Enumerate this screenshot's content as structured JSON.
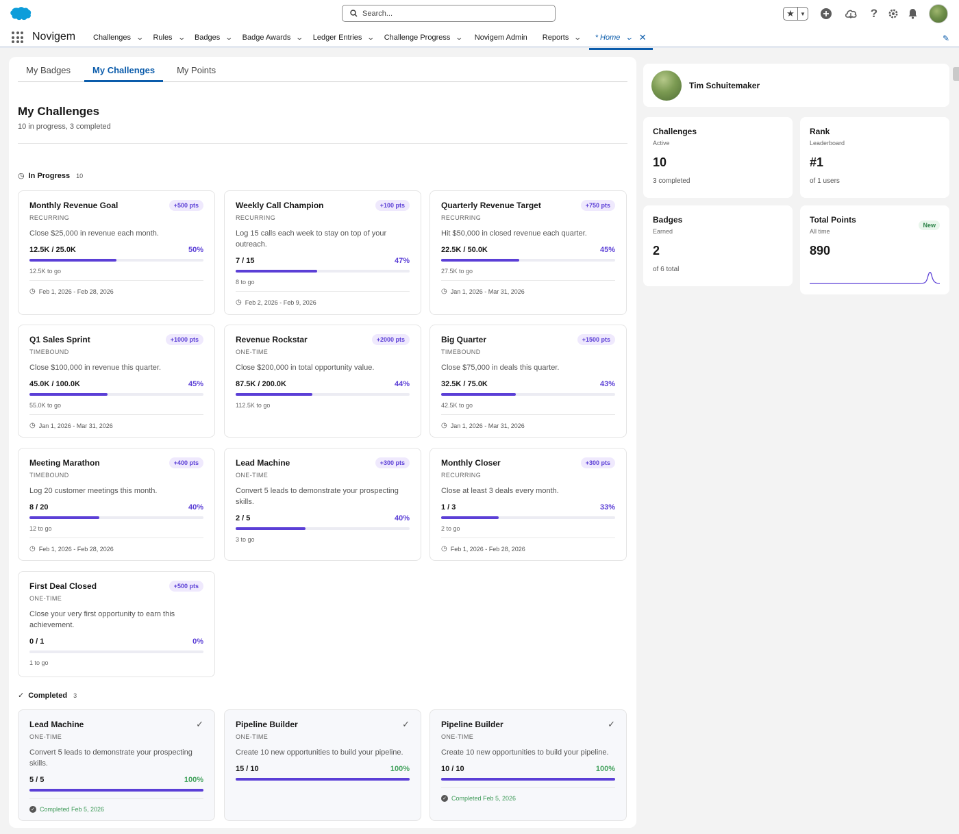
{
  "header": {
    "search_placeholder": "Search...",
    "app_name": "Novigem",
    "nav": [
      {
        "label": "Challenges"
      },
      {
        "label": "Rules"
      },
      {
        "label": "Badges"
      },
      {
        "label": "Badge Awards"
      },
      {
        "label": "Ledger Entries"
      },
      {
        "label": "Challenge Progress"
      },
      {
        "label": "Novigem Admin"
      },
      {
        "label": "Reports"
      },
      {
        "label": "* Home"
      }
    ]
  },
  "tabs": [
    "My Badges",
    "My Challenges",
    "My Points"
  ],
  "page": {
    "title": "My Challenges",
    "subtitle": "10 in progress, 3 completed"
  },
  "sections": {
    "in_progress": {
      "label": "In Progress",
      "count": "10"
    },
    "completed": {
      "label": "Completed",
      "count": "3"
    }
  },
  "in_progress": [
    {
      "name": "Monthly Revenue Goal",
      "points": "+500 pts",
      "type": "RECURRING",
      "desc": "Close $25,000 in revenue each month.",
      "progress": "12.5K / 25.0K",
      "pct": "50%",
      "fraction": 0.5,
      "togo": "12.5K to go",
      "dates": "Feb 1, 2026 - Feb 28, 2026"
    },
    {
      "name": "Weekly Call Champion",
      "points": "+100 pts",
      "type": "RECURRING",
      "desc": "Log 15 calls each week to stay on top of your outreach.",
      "progress": "7 / 15",
      "pct": "47%",
      "fraction": 0.47,
      "togo": "8 to go",
      "dates": "Feb 2, 2026 - Feb 9, 2026"
    },
    {
      "name": "Quarterly Revenue Target",
      "points": "+750 pts",
      "type": "RECURRING",
      "desc": "Hit $50,000 in closed revenue each quarter.",
      "progress": "22.5K / 50.0K",
      "pct": "45%",
      "fraction": 0.45,
      "togo": "27.5K to go",
      "dates": "Jan 1, 2026 - Mar 31, 2026"
    },
    {
      "name": "Q1 Sales Sprint",
      "points": "+1000 pts",
      "type": "TIMEBOUND",
      "desc": "Close $100,000 in revenue this quarter.",
      "progress": "45.0K / 100.0K",
      "pct": "45%",
      "fraction": 0.45,
      "togo": "55.0K to go",
      "dates": "Jan 1, 2026 - Mar 31, 2026"
    },
    {
      "name": "Revenue Rockstar",
      "points": "+2000 pts",
      "type": "ONE-TIME",
      "desc": "Close $200,000 in total opportunity value.",
      "progress": "87.5K / 200.0K",
      "pct": "44%",
      "fraction": 0.44,
      "togo": "112.5K to go",
      "dates": ""
    },
    {
      "name": "Big Quarter",
      "points": "+1500 pts",
      "type": "TIMEBOUND",
      "desc": "Close $75,000 in deals this quarter.",
      "progress": "32.5K / 75.0K",
      "pct": "43%",
      "fraction": 0.43,
      "togo": "42.5K to go",
      "dates": "Jan 1, 2026 - Mar 31, 2026"
    },
    {
      "name": "Meeting Marathon",
      "points": "+400 pts",
      "type": "TIMEBOUND",
      "desc": "Log 20 customer meetings this month.",
      "progress": "8 / 20",
      "pct": "40%",
      "fraction": 0.4,
      "togo": "12 to go",
      "dates": "Feb 1, 2026 - Feb 28, 2026"
    },
    {
      "name": "Lead Machine",
      "points": "+300 pts",
      "type": "ONE-TIME",
      "desc": "Convert 5 leads to demonstrate your prospecting skills.",
      "progress": "2 / 5",
      "pct": "40%",
      "fraction": 0.4,
      "togo": "3 to go",
      "dates": ""
    },
    {
      "name": "Monthly Closer",
      "points": "+300 pts",
      "type": "RECURRING",
      "desc": "Close at least 3 deals every month.",
      "progress": "1 / 3",
      "pct": "33%",
      "fraction": 0.33,
      "togo": "2 to go",
      "dates": "Feb 1, 2026 - Feb 28, 2026"
    },
    {
      "name": "First Deal Closed",
      "points": "+500 pts",
      "type": "ONE-TIME",
      "desc": "Close your very first opportunity to earn this achievement.",
      "progress": "0 / 1",
      "pct": "0%",
      "fraction": 0,
      "togo": "1 to go",
      "dates": ""
    }
  ],
  "completed": [
    {
      "name": "Lead Machine",
      "type": "ONE-TIME",
      "desc": "Convert 5 leads to demonstrate your prospecting skills.",
      "progress": "5 / 5",
      "pct": "100%",
      "fraction": 1,
      "completed": "Completed Feb 5, 2026"
    },
    {
      "name": "Pipeline Builder",
      "type": "ONE-TIME",
      "desc": "Create 10 new opportunities to build your pipeline.",
      "progress": "15 / 10",
      "pct": "100%",
      "fraction": 1,
      "completed": ""
    },
    {
      "name": "Pipeline Builder",
      "type": "ONE-TIME",
      "desc": "Create 10 new opportunities to build your pipeline.",
      "progress": "10 / 10",
      "pct": "100%",
      "fraction": 1,
      "completed": "Completed Feb 5, 2026"
    }
  ],
  "profile": {
    "name": "Tim Schuitemaker"
  },
  "stats": {
    "challenges": {
      "title": "Challenges",
      "sub": "Active",
      "value": "10",
      "detail": "3 completed"
    },
    "rank": {
      "title": "Rank",
      "sub": "Leaderboard",
      "value": "#1",
      "detail": "of 1 users"
    },
    "badges": {
      "title": "Badges",
      "sub": "Earned",
      "value": "2",
      "detail": "of 6 total"
    },
    "points": {
      "title": "Total Points",
      "sub": "All time",
      "value": "890",
      "badge": "New"
    }
  },
  "colors": {
    "accent": "#5b3fd6",
    "nav_active": "#0b5cab",
    "success": "#45a35f"
  },
  "icons": [
    "salesforce-cloud-icon",
    "search-icon",
    "favorite-star-icon",
    "add-icon",
    "setup-assistant-icon",
    "help-icon",
    "gear-icon",
    "bell-icon",
    "app-launcher-icon",
    "clock-icon",
    "check-icon",
    "edit-pencil-icon"
  ]
}
